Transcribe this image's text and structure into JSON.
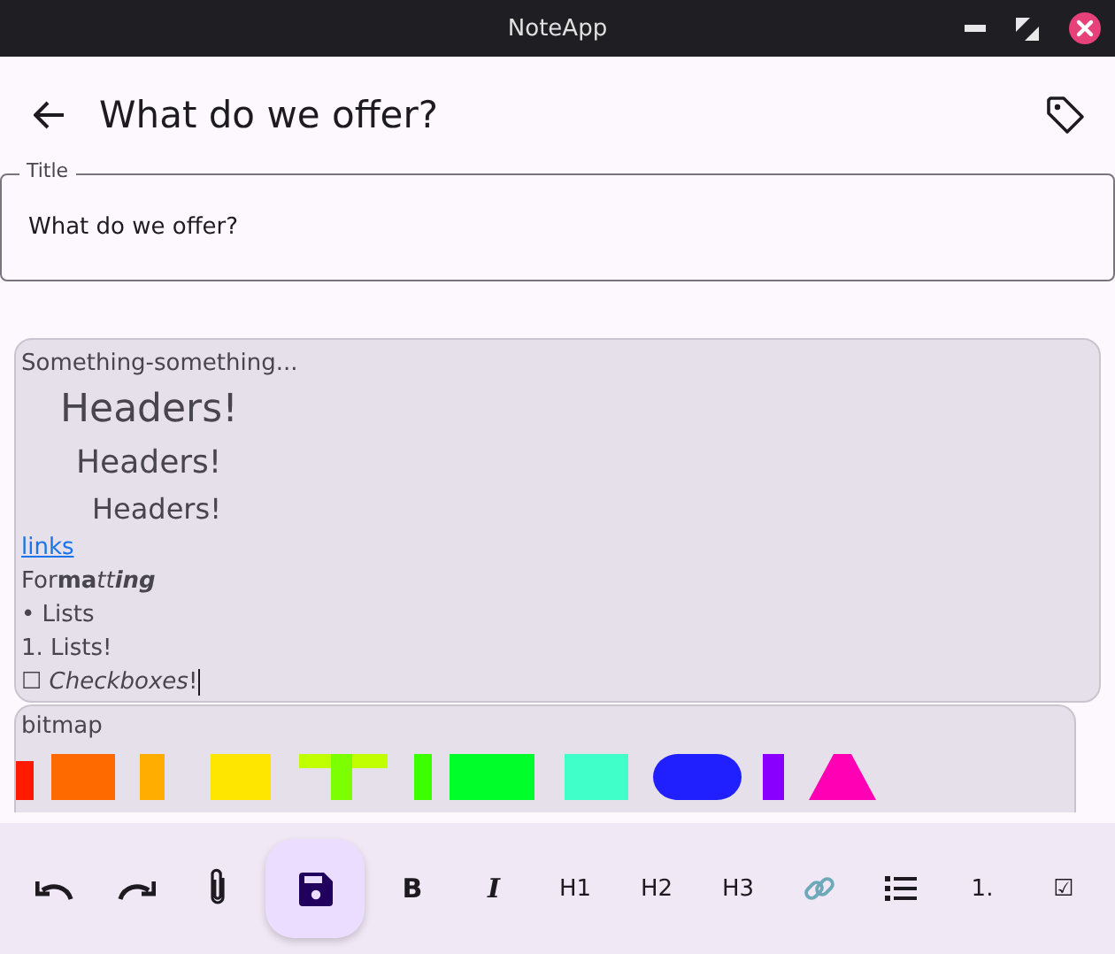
{
  "window": {
    "title": "NoteApp"
  },
  "app_bar": {
    "title": "What do we offer?"
  },
  "title_field": {
    "label": "Title",
    "value": "What do we offer?"
  },
  "note": {
    "lines": [
      {
        "kind": "text",
        "text": "Something-something..."
      },
      {
        "kind": "h1",
        "text": "Headers!"
      },
      {
        "kind": "h2",
        "text": "Headers!"
      },
      {
        "kind": "h3",
        "text": "Headers!"
      },
      {
        "kind": "link",
        "text": "links"
      },
      {
        "kind": "formatted",
        "segments": [
          {
            "text": "For",
            "bold": false,
            "italic": false
          },
          {
            "text": "ma",
            "bold": true,
            "italic": false
          },
          {
            "text": "tt",
            "bold": false,
            "italic": true
          },
          {
            "text": "ing",
            "bold": true,
            "italic": true
          }
        ]
      },
      {
        "kind": "text",
        "text": "• Lists"
      },
      {
        "kind": "text",
        "text": "1. Lists!"
      },
      {
        "kind": "text",
        "text": "☐ *Checkboxes*!"
      }
    ]
  },
  "attachment": {
    "label": "bitmap",
    "kind": "picture"
  },
  "toolbar": [
    {
      "kind": "undo"
    },
    {
      "kind": "redo"
    },
    {
      "kind": "attach"
    },
    {
      "kind": "save",
      "selected": true
    },
    {
      "kind": "bold",
      "text": "B",
      "selected": false
    },
    {
      "kind": "italic",
      "text": "I",
      "selected": false
    },
    {
      "kind": "text",
      "text": "H1",
      "selected": false
    },
    {
      "kind": "text",
      "text": "H2",
      "selected": false
    },
    {
      "kind": "text",
      "text": "H3",
      "selected": false
    },
    {
      "kind": "link"
    },
    {
      "kind": "list"
    },
    {
      "kind": "text",
      "text": "1.",
      "selected": false
    },
    {
      "kind": "text",
      "text": "☑",
      "selected": false
    }
  ]
}
